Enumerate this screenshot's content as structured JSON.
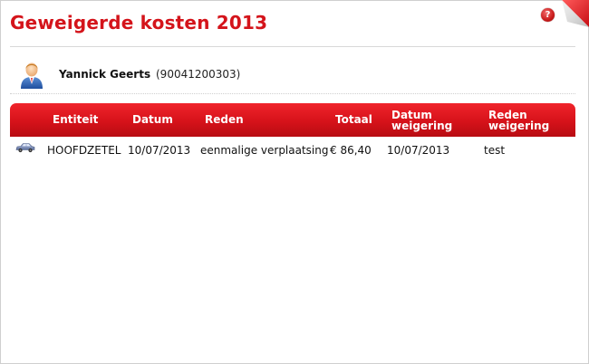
{
  "header": {
    "title": "Geweigerde kosten 2013",
    "help_icon": "help-icon",
    "help_glyph": "?"
  },
  "user": {
    "name": "Yannick Geerts",
    "id": "(90041200303)",
    "avatar_icon": "user-avatar-icon"
  },
  "table": {
    "columns": {
      "entiteit": "Entiteit",
      "datum": "Datum",
      "reden": "Reden",
      "totaal": "Totaal",
      "datum_weigering_1": "Datum",
      "datum_weigering_2": "weigering",
      "reden_weigering_1": "Reden",
      "reden_weigering_2": "weigering"
    },
    "rows": [
      {
        "icon": "car-icon",
        "entiteit": "HOOFDZETEL",
        "datum": "10/07/2013",
        "reden": "eenmalige verplaatsing",
        "totaal": "€ 86,40",
        "datum_weigering": "10/07/2013",
        "reden_weigering": "test"
      }
    ]
  },
  "colors": {
    "accent": "#d4141b",
    "header_bg": "#d6121a"
  }
}
